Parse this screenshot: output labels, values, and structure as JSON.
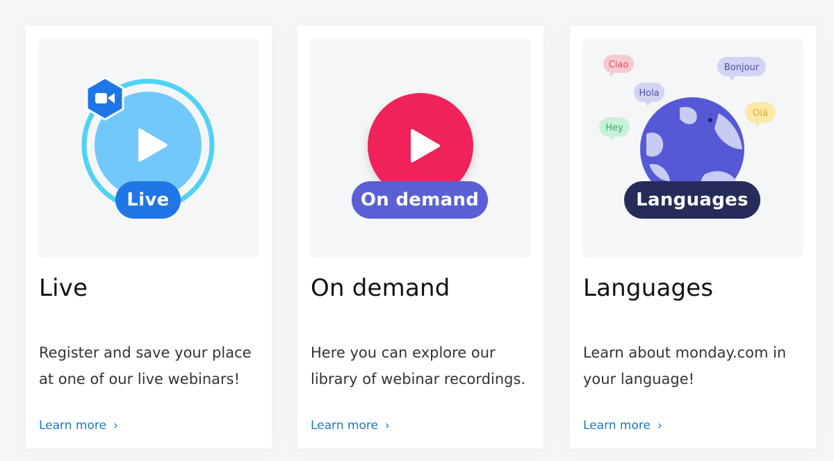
{
  "cards": [
    {
      "badge": "Live",
      "title": "Live",
      "description": "Register and save your place at one of our live webinars!",
      "link": "Learn more",
      "colors": {
        "ring": "#4fd2f7",
        "disc": "#72c8fb",
        "badge": "#1f76e6",
        "hex": "#1f76e6"
      },
      "icons": [
        "play-icon",
        "video-camera-icon"
      ]
    },
    {
      "badge": "On demand",
      "title": "On demand",
      "description": "Here you can explore our library of webinar recordings.",
      "link": "Learn more",
      "colors": {
        "disc": "#f0225a",
        "badge": "#5b5fd6"
      },
      "icons": [
        "play-icon"
      ]
    },
    {
      "badge": "Languages",
      "title": "Languages",
      "description": "Learn about monday.com in your language!",
      "link": "Learn more",
      "colors": {
        "globe": "#5559d6",
        "land": "#c8cbf2",
        "badge": "#262b5a"
      },
      "icons": [
        "globe-icon"
      ],
      "bubbles": [
        "Ciao",
        "Bonjour",
        "Hola",
        "Olá",
        "Hey"
      ]
    }
  ]
}
